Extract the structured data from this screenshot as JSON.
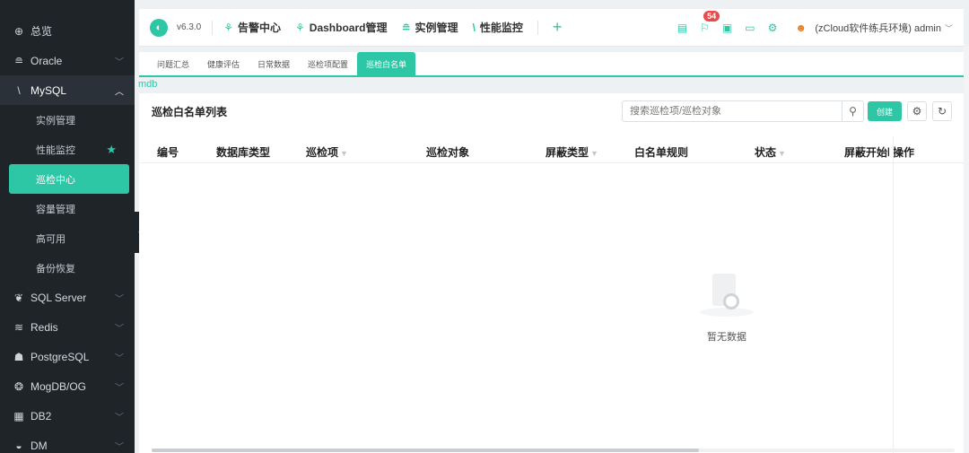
{
  "sidebar": {
    "items": [
      {
        "label": "总览",
        "icon": "dashboard-icon",
        "glyph": "⊕"
      },
      {
        "label": "Oracle",
        "icon": "database-icon",
        "glyph": "≘"
      },
      {
        "label": "MySQL",
        "icon": "mysql-icon",
        "glyph": "\\"
      },
      {
        "label": "SQL Server",
        "icon": "sqlserver-icon",
        "glyph": "❦"
      },
      {
        "label": "Redis",
        "icon": "redis-icon",
        "glyph": "≋"
      },
      {
        "label": "PostgreSQL",
        "icon": "postgresql-icon",
        "glyph": "☗"
      },
      {
        "label": "MogDB/OG",
        "icon": "mogdb-icon",
        "glyph": "❂"
      },
      {
        "label": "DB2",
        "icon": "db2-icon",
        "glyph": "▦"
      },
      {
        "label": "DM",
        "icon": "dm-icon",
        "glyph": "◒"
      }
    ],
    "mysql_sub": [
      "实例管理",
      "性能监控",
      "巡检中心",
      "容量管理",
      "高可用",
      "备份恢复"
    ]
  },
  "topbar": {
    "version": "v6.3.0",
    "nav": [
      {
        "label": "告警中心",
        "icon": "alarm-icon",
        "glyph": "⚘"
      },
      {
        "label": "Dashboard管理",
        "icon": "dashboard-manage-icon",
        "glyph": "⚘"
      },
      {
        "label": "实例管理",
        "icon": "instance-icon",
        "glyph": "≘"
      },
      {
        "label": "性能监控",
        "icon": "performance-icon",
        "glyph": "\\"
      }
    ],
    "plus": "+",
    "badge_count": "54",
    "env_user": "(zCloud软件练兵环境) admin"
  },
  "tabs": [
    "问题汇总",
    "健康评估",
    "日常数据",
    "巡检项配置",
    "巡检白名单"
  ],
  "breadcrumb": "mdb",
  "panel": {
    "title": "巡检白名单列表",
    "search_placeholder": "搜索巡检项/巡检对象",
    "create_label": "创建",
    "columns": [
      "编号",
      "数据库类型",
      "巡检项",
      "巡检对象",
      "屏蔽类型",
      "白名单规则",
      "状态",
      "屏蔽开始时间",
      "操作"
    ],
    "empty_text": "暂无数据"
  },
  "colors": {
    "accent": "#2ec7a5",
    "sidebar_bg": "#1f2429",
    "badge": "#e84b4b"
  }
}
